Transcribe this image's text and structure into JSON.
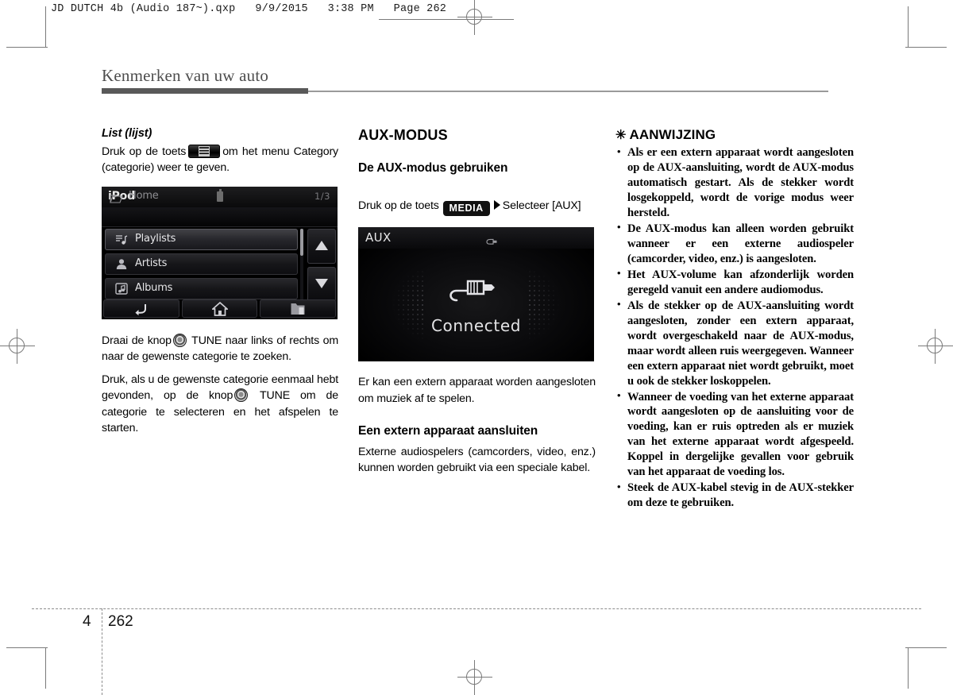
{
  "print_header": {
    "text": "JD DUTCH 4b (Audio 187~).qxp   9/9/2015   3:38 PM   Page 262"
  },
  "chapter": {
    "title": "Kenmerken van uw auto"
  },
  "left_column": {
    "heading": "List (lijst)",
    "intro_before_key": "Druk op de toets",
    "key_icon": "list-button-icon",
    "intro_after_key": "om het menu Category (categorie) weer te geven.",
    "device": {
      "title": "iPod",
      "status_icon": "usb-device-icon",
      "path_icon": "folder-icon",
      "path_label": "Home",
      "page_count": "1/3",
      "rows": [
        {
          "label": "Playlists",
          "icon": "playlist-icon",
          "selected": true
        },
        {
          "label": "Artists",
          "icon": "person-icon",
          "selected": false
        },
        {
          "label": "Albums",
          "icon": "album-note-icon",
          "selected": false
        }
      ],
      "scroll_up_icon": "triangle-up-icon",
      "scroll_down_icon": "triangle-down-icon",
      "nav_buttons": [
        {
          "icon": "back-arrow-icon"
        },
        {
          "icon": "home-icon"
        },
        {
          "icon": "folder-up-icon"
        }
      ]
    },
    "paragraph_1_a": "Draai de knop",
    "knob_icon": "tune-knob-icon",
    "paragraph_1_b": "TUNE naar links of rechts om naar de gewenste categorie te zoeken.",
    "paragraph_2_a": "Druk, als u de gewenste categorie eenmaal hebt gevonden, op de knop",
    "paragraph_2_b": "TUNE om de categorie te selecteren en het afspelen te starten."
  },
  "middle_column": {
    "section_title": "AUX-MODUS",
    "sub_heading": "De AUX-modus gebruiken",
    "instruction_before_key": "Druk op de toets",
    "media_key_label": "MEDIA",
    "arrow_icon": "right-triangle-icon",
    "instruction_after_key": "Selecteer [AUX]",
    "device": {
      "title": "AUX",
      "status_icon": "aux-plug-icon",
      "center_icon": "aux-cable-plug-icon",
      "status_text": "Connected"
    },
    "paragraph_1": "Er kan een extern apparaat worden aangesloten om muziek af te spelen.",
    "sub_heading_2": "Een extern apparaat aansluiten",
    "paragraph_2": "Externe audiospelers (camcorders, video, enz.) kunnen worden gebruikt via een speciale kabel."
  },
  "right_column": {
    "notice_star": "✳",
    "notice_title": "AANWIJZING",
    "bullets": [
      "Als er een extern apparaat wordt aangesloten op de AUX-aansluiting, wordt de AUX-modus automatisch gestart. Als de stekker wordt losgekoppeld, wordt de vorige modus weer hersteld.",
      "De AUX-modus kan alleen worden gebruikt wanneer er een externe audiospeler (camcorder, video, enz.) is aangesloten.",
      "Het AUX-volume kan afzonderlijk worden geregeld vanuit een andere audiomodus.",
      "Als de stekker op de AUX-aansluiting wordt aangesloten, zonder een extern apparaat, wordt overgeschakeld naar de AUX-modus, maar wordt alleen ruis weergegeven. Wanneer een extern apparaat niet wordt gebruikt, moet u ook de stekker loskoppelen.",
      "Wanneer de voeding van het externe apparaat wordt aangesloten op de aansluiting voor de voeding, kan er ruis optreden als er muziek van het externe apparaat wordt afgespeeld. Koppel in dergelijke gevallen voor gebruik van het apparaat de voeding los.",
      "Steek de AUX-kabel stevig in de AUX-stekker om deze te gebruiken."
    ]
  },
  "footer": {
    "chapter_number": "4",
    "page_number": "262"
  }
}
